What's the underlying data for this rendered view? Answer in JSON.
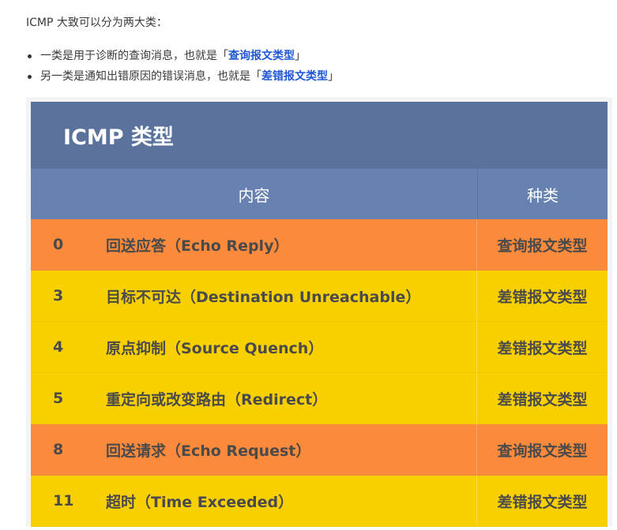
{
  "intro": "ICMP 大致可以分为两大类：",
  "bullets": [
    {
      "prefix": "一类是用于诊断的查询消息，也就是「",
      "highlight": "查询报文类型",
      "suffix": "」"
    },
    {
      "prefix": "另一类是通知出错原因的错误消息，也就是「",
      "highlight": "差错报文类型",
      "suffix": "」"
    }
  ],
  "colors": {
    "query_row": "#fb8a3c",
    "error_row": "#f8d000",
    "title_bg": "#5b739c",
    "header_bg": "#6782b1",
    "highlight": "#1f56d6"
  },
  "table": {
    "title": "ICMP 类型",
    "headers": {
      "content": "内容",
      "kind": "种类"
    },
    "rows": [
      {
        "num": "0",
        "content": "回送应答（Echo Reply）",
        "kind": "查询报文类型",
        "color": "orange"
      },
      {
        "num": "3",
        "content": "目标不可达（Destination Unreachable）",
        "kind": "差错报文类型",
        "color": "yellow"
      },
      {
        "num": "4",
        "content": "原点抑制（Source Quench）",
        "kind": "差错报文类型",
        "color": "yellow"
      },
      {
        "num": "5",
        "content": "重定向或改变路由（Redirect）",
        "kind": "差错报文类型",
        "color": "yellow"
      },
      {
        "num": "8",
        "content": "回送请求（Echo Request）",
        "kind": "查询报文类型",
        "color": "orange"
      },
      {
        "num": "11",
        "content": "超时（Time Exceeded）",
        "kind": "差错报文类型",
        "color": "yellow"
      }
    ]
  }
}
